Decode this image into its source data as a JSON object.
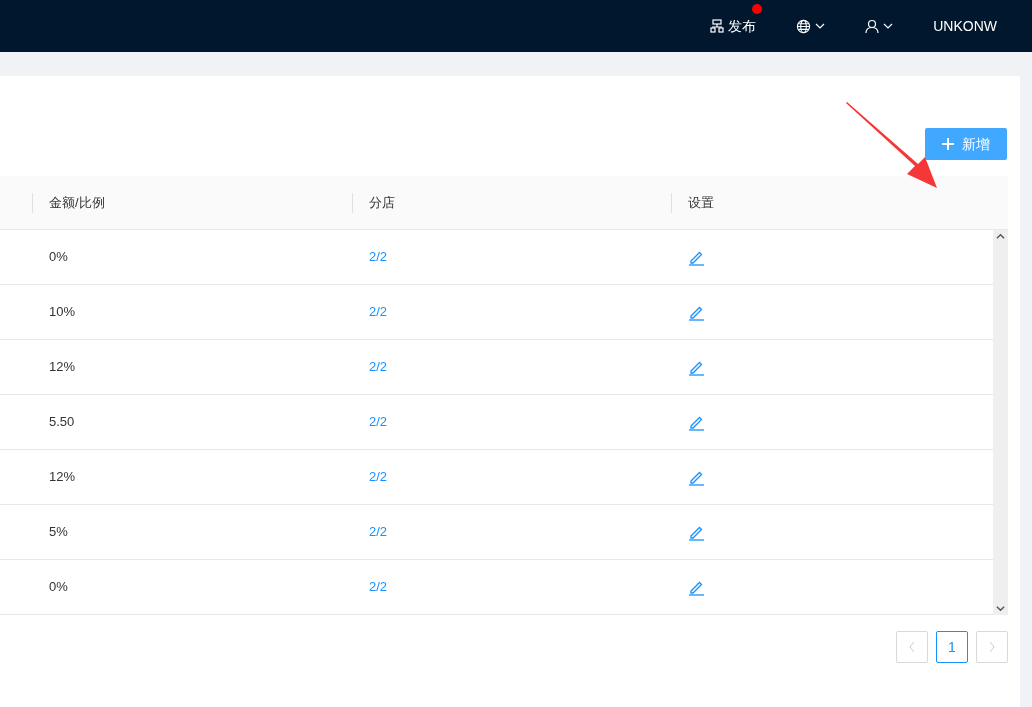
{
  "header": {
    "publish": {
      "label": "发布",
      "badge": true
    },
    "username": "UNKONW"
  },
  "add_button": {
    "label": "新增"
  },
  "table": {
    "columns": [
      "金额/比例",
      "分店",
      "设置"
    ],
    "rows": [
      {
        "amount": "0%",
        "store": "2/2"
      },
      {
        "amount": "10%",
        "store": "2/2"
      },
      {
        "amount": "12%",
        "store": "2/2"
      },
      {
        "amount": "5.50",
        "store": "2/2"
      },
      {
        "amount": "12%",
        "store": "2/2"
      },
      {
        "amount": "5%",
        "store": "2/2"
      },
      {
        "amount": "0%",
        "store": "2/2"
      }
    ]
  },
  "pagination": {
    "prev_disabled": true,
    "next_disabled": true,
    "pages": [
      {
        "label": "1",
        "selected": true
      }
    ]
  }
}
